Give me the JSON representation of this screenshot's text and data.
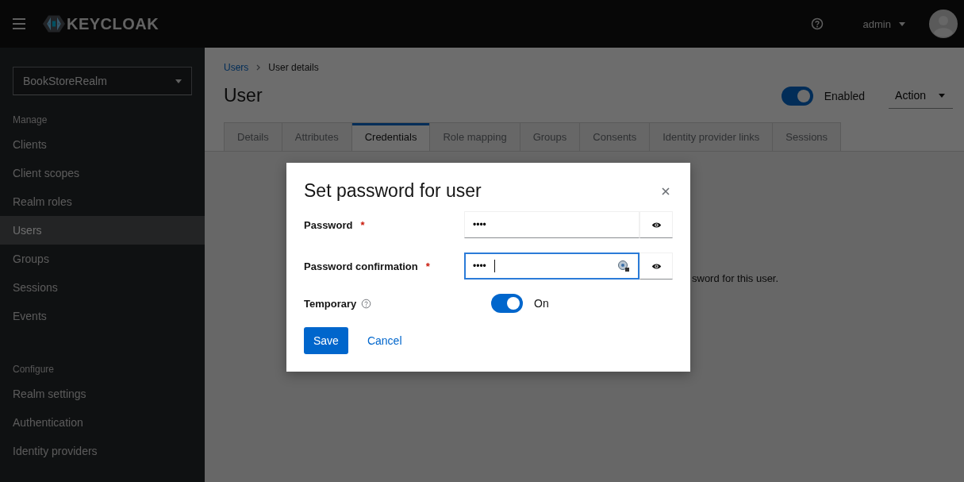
{
  "header": {
    "logo": "KEYCLOAK",
    "user": "admin"
  },
  "sidebar": {
    "realm": "BookStoreRealm",
    "sections": [
      {
        "heading": "Manage",
        "items": [
          {
            "label": "Clients",
            "selected": false
          },
          {
            "label": "Client scopes",
            "selected": false
          },
          {
            "label": "Realm roles",
            "selected": false
          },
          {
            "label": "Users",
            "selected": true
          },
          {
            "label": "Groups",
            "selected": false
          },
          {
            "label": "Sessions",
            "selected": false
          },
          {
            "label": "Events",
            "selected": false
          }
        ]
      },
      {
        "heading": "Configure",
        "items": [
          {
            "label": "Realm settings",
            "selected": false
          },
          {
            "label": "Authentication",
            "selected": false
          },
          {
            "label": "Identity providers",
            "selected": false
          }
        ]
      }
    ]
  },
  "breadcrumb": [
    {
      "label": "Users",
      "kind": "link"
    },
    {
      "label": "User details",
      "kind": "current"
    }
  ],
  "page": {
    "title": "User",
    "enabled": true,
    "enabled_label": "Enabled",
    "action": "Action"
  },
  "tabs": [
    {
      "label": "Details",
      "selected": false
    },
    {
      "label": "Attributes",
      "selected": false
    },
    {
      "label": "Credentials",
      "selected": true
    },
    {
      "label": "Role mapping",
      "selected": false
    },
    {
      "label": "Groups",
      "selected": false
    },
    {
      "label": "Consents",
      "selected": false
    },
    {
      "label": "Identity provider links",
      "selected": false
    },
    {
      "label": "Sessions",
      "selected": false
    }
  ],
  "background_text": "sword for this user.",
  "dialog": {
    "title": "Set password for user",
    "fields": [
      {
        "label": "Password",
        "required_mark": "*",
        "value": "••••",
        "focused": false,
        "autofill_icon": false
      },
      {
        "label": "Password confirmation",
        "required_mark": "*",
        "value": "••••",
        "focused": true,
        "autofill_icon": true
      }
    ],
    "temporary": {
      "label": "Temporary",
      "on": true,
      "state_label": "On"
    },
    "buttons": [
      {
        "label": "Save",
        "kind": "primary"
      },
      {
        "label": "Cancel",
        "kind": "link"
      }
    ]
  }
}
